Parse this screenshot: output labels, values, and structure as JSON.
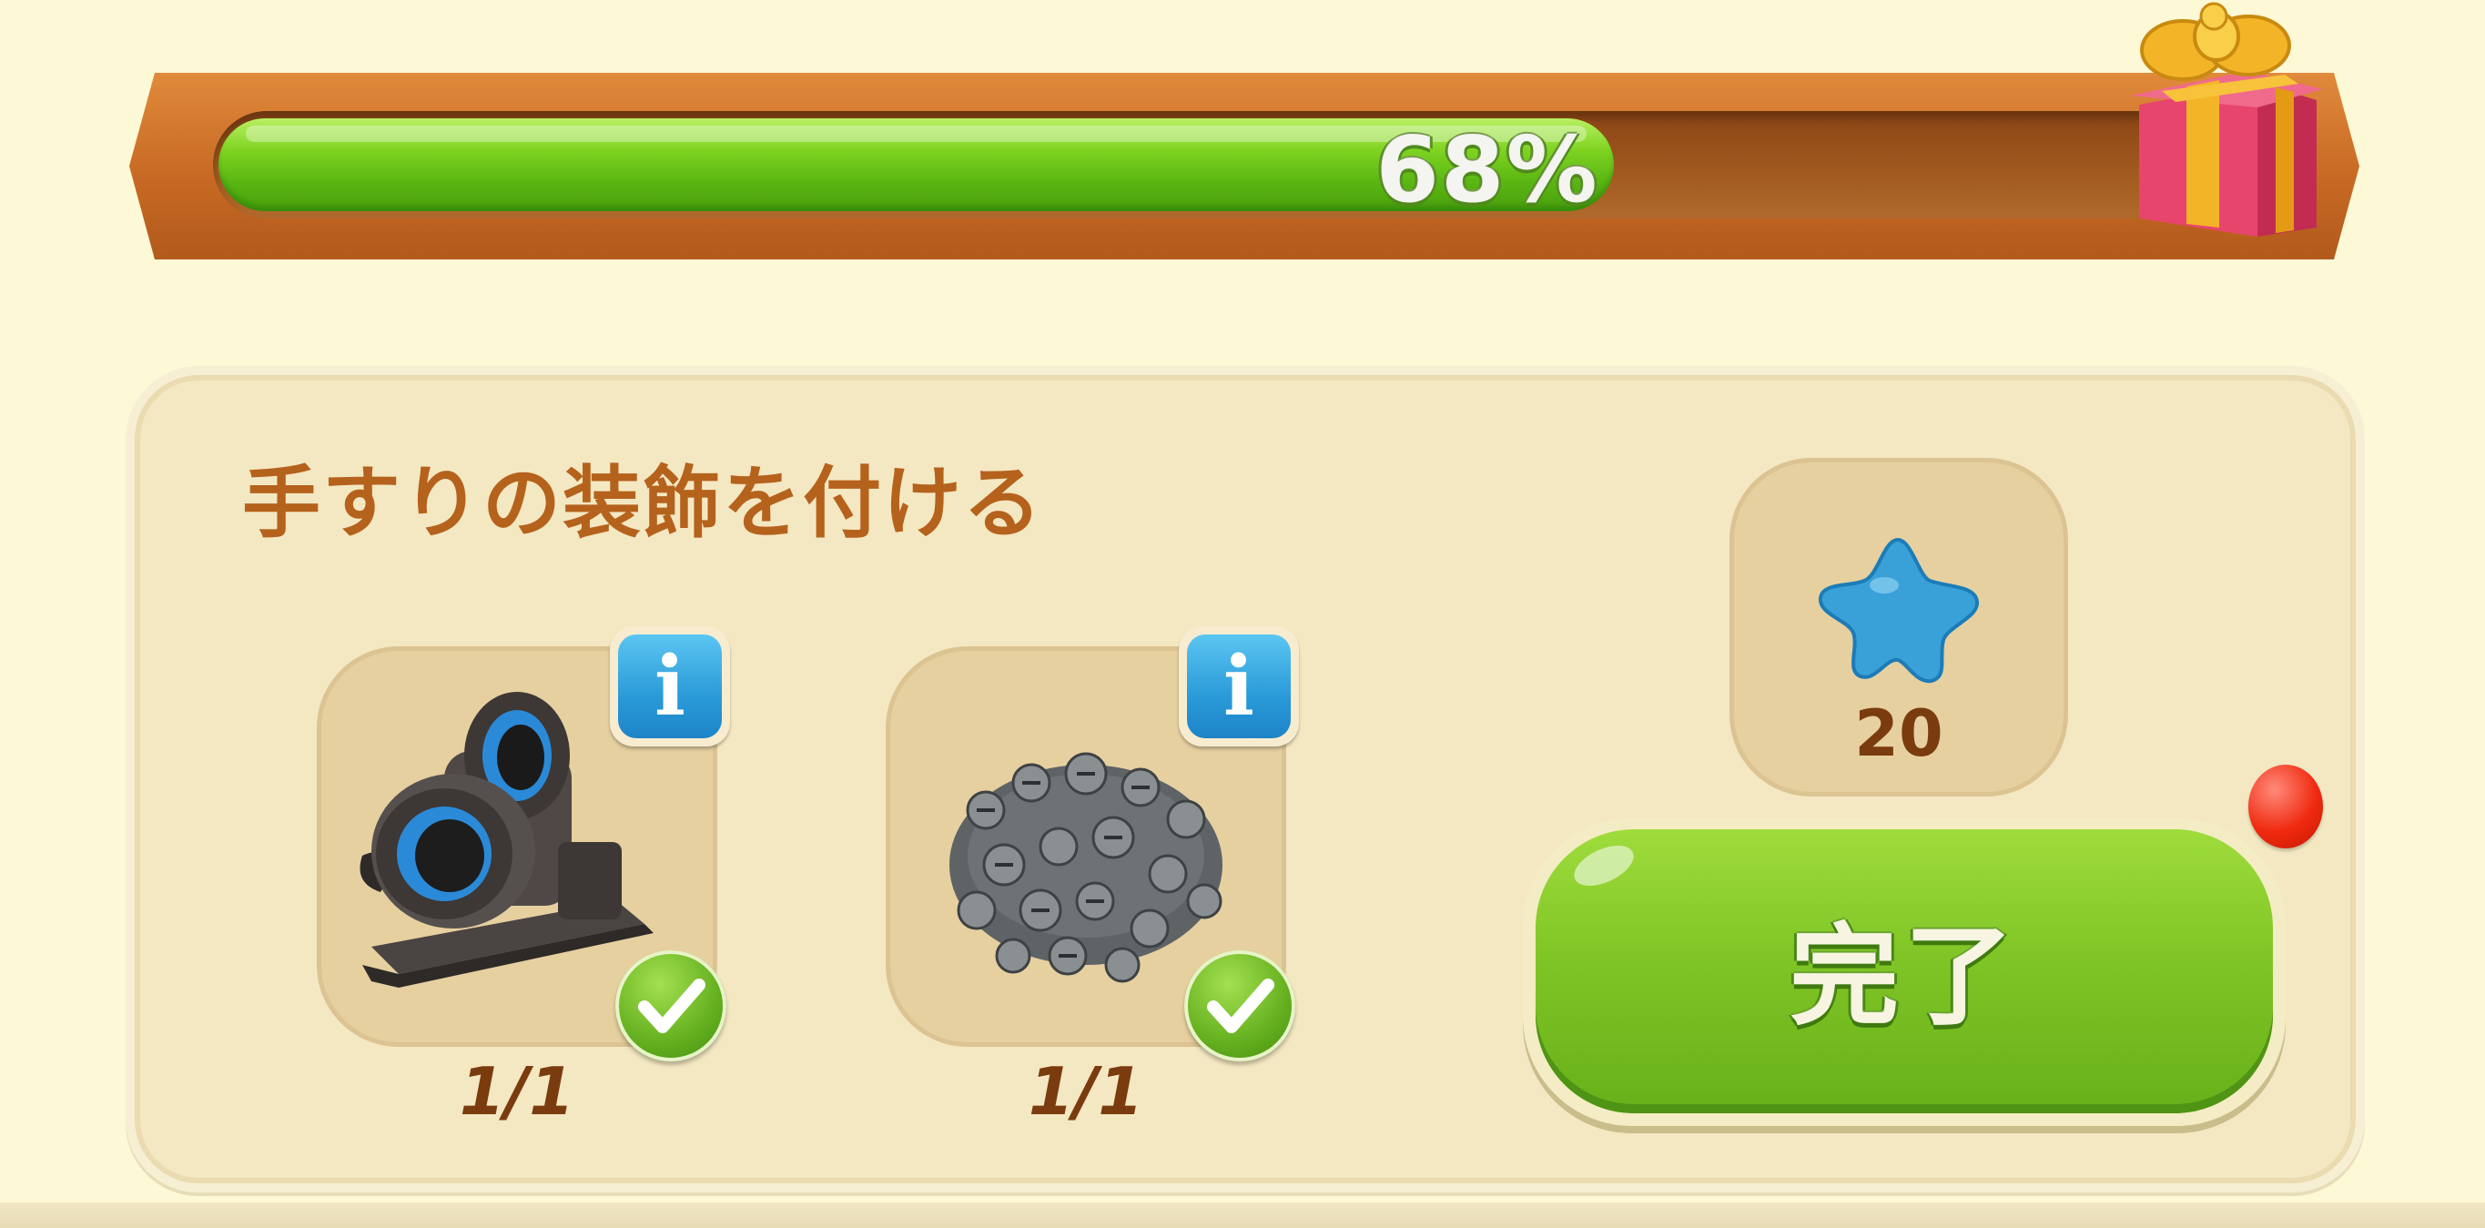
{
  "progress": {
    "percent_label": "68%",
    "value": 0.68
  },
  "task": {
    "title": "手すりの装飾を付ける",
    "items": [
      {
        "name": "duct-tape",
        "count": "1/1",
        "completed": true
      },
      {
        "name": "screws",
        "count": "1/1",
        "completed": true
      }
    ],
    "reward": {
      "icon": "blue-star-icon",
      "value": "20"
    },
    "complete_button": {
      "label": "完了",
      "has_notification": true
    }
  },
  "colors": {
    "background": "#fdf8d6",
    "title": "#b5621d",
    "progress_fill": "#7ed321",
    "button": "#80c526",
    "info": "#2a9ad8",
    "notification": "#f02a10"
  }
}
